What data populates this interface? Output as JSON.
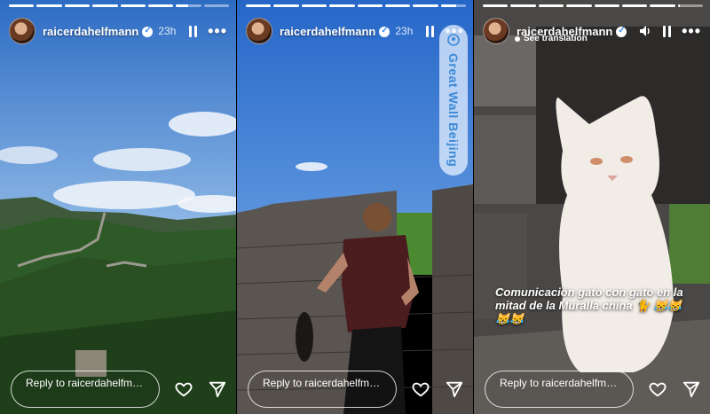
{
  "stories": [
    {
      "username": "raicerdahelfmann",
      "time": "23h",
      "progress": [
        1,
        1,
        1,
        1,
        1,
        1,
        0.5,
        0
      ],
      "reply_placeholder": "Reply to raicerdahelfmann..."
    },
    {
      "username": "raicerdahelfmann",
      "time": "23h",
      "progress": [
        1,
        1,
        1,
        1,
        1,
        1,
        1,
        0.6
      ],
      "location_sticker": "Great Wall Beijing",
      "reply_placeholder": "Reply to raicerdahelfmann..."
    },
    {
      "username": "raicerdahelfmann",
      "progress": [
        1,
        1,
        1,
        1,
        1,
        1,
        1,
        0.1
      ],
      "see_translation": "See translation",
      "caption": "Comunicación gato con gato en la mitad de la Muralla china 🐈 😹😹😹😹",
      "reply_placeholder": "Reply to raicerdahelfmann..."
    }
  ],
  "icons": {
    "verified": "verified-badge-icon",
    "pause": "pause-icon",
    "more": "more-options-icon",
    "sound": "speaker-icon",
    "like": "heart-icon",
    "share": "send-icon",
    "location": "location-pin-icon"
  },
  "colors": {
    "sky": "#3e7fd0",
    "location_text": "#3c8ad8"
  }
}
